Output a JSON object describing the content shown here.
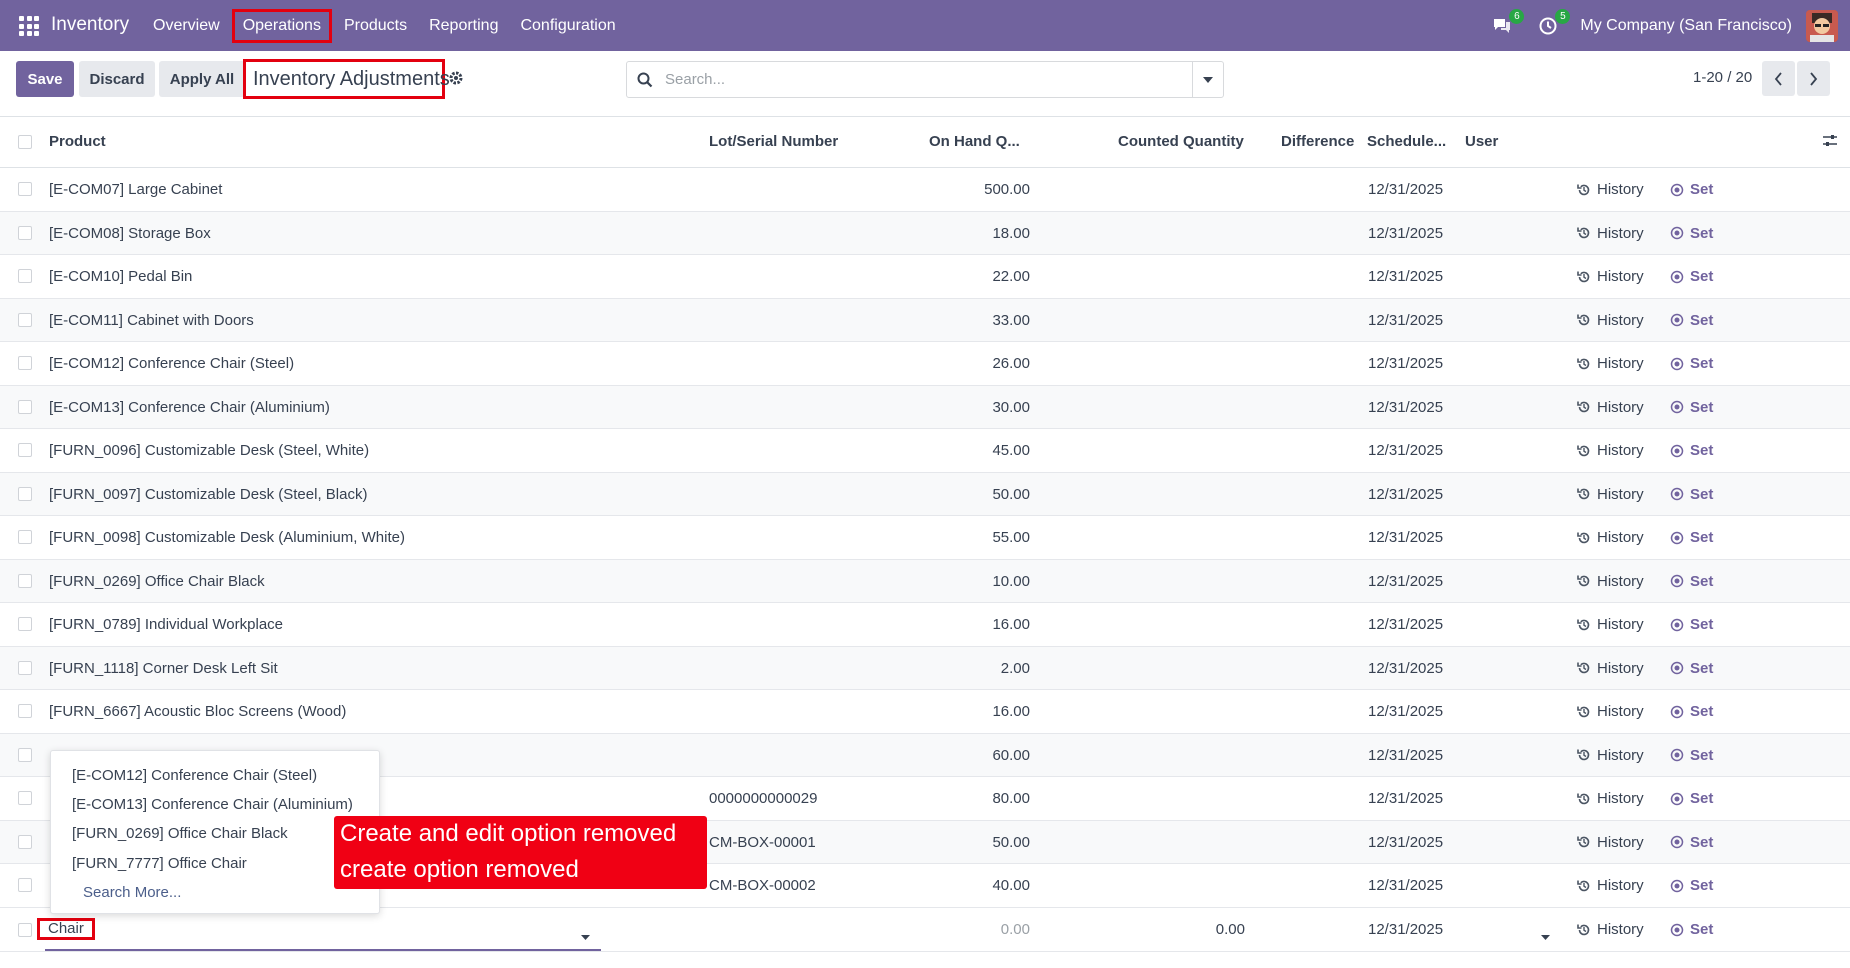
{
  "navbar": {
    "app_title": "Inventory",
    "menu": [
      "Overview",
      "Operations",
      "Products",
      "Reporting",
      "Configuration"
    ],
    "messages_badge": "6",
    "activities_badge": "5",
    "company": "My Company (San Francisco)"
  },
  "control_panel": {
    "save_label": "Save",
    "discard_label": "Discard",
    "apply_all_label": "Apply All",
    "title": "Inventory Adjustments",
    "search_placeholder": "Search...",
    "pager": "1-20 / 20"
  },
  "table": {
    "columns": {
      "product": "Product",
      "lot": "Lot/Serial Number",
      "on_hand": "On Hand Q...",
      "counted": "Counted Quantity",
      "difference": "Difference",
      "scheduled": "Schedule...",
      "user": "User"
    },
    "history_label": "History",
    "set_label": "Set",
    "rows": [
      {
        "product": "[E-COM07] Large Cabinet",
        "lot": "",
        "on_hand": "500.00",
        "date": "12/31/2025"
      },
      {
        "product": "[E-COM08] Storage Box",
        "lot": "",
        "on_hand": "18.00",
        "date": "12/31/2025"
      },
      {
        "product": "[E-COM10] Pedal Bin",
        "lot": "",
        "on_hand": "22.00",
        "date": "12/31/2025"
      },
      {
        "product": "[E-COM11] Cabinet with Doors",
        "lot": "",
        "on_hand": "33.00",
        "date": "12/31/2025"
      },
      {
        "product": "[E-COM12] Conference Chair (Steel)",
        "lot": "",
        "on_hand": "26.00",
        "date": "12/31/2025"
      },
      {
        "product": "[E-COM13] Conference Chair (Aluminium)",
        "lot": "",
        "on_hand": "30.00",
        "date": "12/31/2025"
      },
      {
        "product": "[FURN_0096] Customizable Desk (Steel, White)",
        "lot": "",
        "on_hand": "45.00",
        "date": "12/31/2025"
      },
      {
        "product": "[FURN_0097] Customizable Desk (Steel, Black)",
        "lot": "",
        "on_hand": "50.00",
        "date": "12/31/2025"
      },
      {
        "product": "[FURN_0098] Customizable Desk (Aluminium, White)",
        "lot": "",
        "on_hand": "55.00",
        "date": "12/31/2025"
      },
      {
        "product": "[FURN_0269] Office Chair Black",
        "lot": "",
        "on_hand": "10.00",
        "date": "12/31/2025"
      },
      {
        "product": "[FURN_0789] Individual Workplace",
        "lot": "",
        "on_hand": "16.00",
        "date": "12/31/2025"
      },
      {
        "product": "[FURN_1118] Corner Desk Left Sit",
        "lot": "",
        "on_hand": "2.00",
        "date": "12/31/2025"
      },
      {
        "product": "[FURN_6667] Acoustic Bloc Screens (Wood)",
        "lot": "",
        "on_hand": "16.00",
        "date": "12/31/2025"
      },
      {
        "product": "",
        "lot": "",
        "on_hand": "60.00",
        "date": "12/31/2025"
      },
      {
        "product": "",
        "lot": "0000000000029",
        "on_hand": "80.00",
        "date": "12/31/2025"
      },
      {
        "product": "",
        "lot": "CM-BOX-00001",
        "on_hand": "50.00",
        "date": "12/31/2025"
      },
      {
        "product": "",
        "lot": "CM-BOX-00002",
        "on_hand": "40.00",
        "date": "12/31/2025"
      }
    ],
    "edit_row": {
      "product_input": "Chair",
      "on_hand": "0.00",
      "counted": "0.00",
      "date": "12/31/2025"
    }
  },
  "dropdown": {
    "items": [
      "[E-COM12] Conference Chair (Steel)",
      "[E-COM13] Conference Chair (Aluminium)",
      "[FURN_0269] Office Chair Black",
      "[FURN_7777] Office Chair"
    ],
    "search_more": "Search More..."
  },
  "callout": {
    "line1": "Create and edit option removed",
    "line2": "create option removed"
  },
  "colors": {
    "brand": "#71639e",
    "highlight": "#e3000f",
    "callout": "#f00014",
    "badge": "#28a745"
  }
}
